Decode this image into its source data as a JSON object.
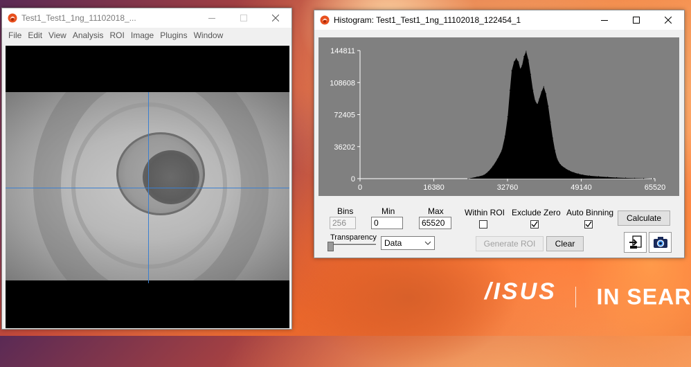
{
  "image_window": {
    "title": "Test1_Test1_1ng_11102018_...",
    "menu": [
      "File",
      "Edit",
      "View",
      "Analysis",
      "ROI",
      "Image",
      "Plugins",
      "Window"
    ]
  },
  "histogram_window": {
    "title": "Histogram: Test1_Test1_1ng_11102018_122454_1",
    "controls": {
      "bins_label": "Bins",
      "bins_value": "256",
      "min_label": "Min",
      "min_value": "0",
      "max_label": "Max",
      "max_value": "65520",
      "within_roi_label": "Within ROI",
      "within_roi_checked": false,
      "exclude_zero_label": "Exclude Zero",
      "exclude_zero_checked": true,
      "auto_binning_label": "Auto Binning",
      "auto_binning_checked": true,
      "calculate_label": "Calculate",
      "transparency_label": "Transparency",
      "transparency_level": 0.0,
      "data_select_value": "Data",
      "generate_roi_label": "Generate ROI",
      "clear_label": "Clear"
    }
  },
  "chart_data": {
    "type": "area",
    "title": "",
    "xlabel": "",
    "ylabel": "",
    "xlim": [
      0,
      65520
    ],
    "ylim": [
      0,
      144811
    ],
    "x_ticks": [
      "0",
      "16380",
      "32760",
      "49140",
      "65520"
    ],
    "y_ticks": [
      "0",
      "36202",
      "72405",
      "108608",
      "144811"
    ],
    "grid": false,
    "fill_color": "#000000",
    "background_color": "#808080",
    "x": [
      24000,
      26000,
      27500,
      28500,
      29500,
      30500,
      31500,
      32200,
      32800,
      33300,
      33700,
      34200,
      34700,
      35200,
      35600,
      36000,
      36400,
      36900,
      37400,
      37900,
      38400,
      38900,
      39400,
      39800,
      40300,
      40800,
      41300,
      41800,
      42300,
      42800,
      43300,
      43800,
      44500,
      45500,
      46500,
      47500,
      48500,
      49500,
      51000,
      53000,
      55000,
      57000,
      59000,
      61000,
      63000,
      65000
    ],
    "values": [
      0,
      2000,
      4000,
      8000,
      14000,
      22000,
      32000,
      48000,
      70000,
      100000,
      122000,
      132000,
      136000,
      132000,
      124000,
      128000,
      138000,
      144000,
      134000,
      118000,
      100000,
      88000,
      84000,
      90000,
      98000,
      104000,
      96000,
      82000,
      64000,
      46000,
      32000,
      22000,
      16000,
      12000,
      9000,
      7000,
      5500,
      4300,
      3200,
      2400,
      1800,
      1200,
      800,
      500,
      300,
      0
    ],
    "line_color": "#000000"
  },
  "desktop": {
    "brand_logo": "/ISUS",
    "brand_tagline": "IN SEARC"
  },
  "colors": {
    "crosshair": "#3a7fd0",
    "plot_bg": "#808080"
  }
}
